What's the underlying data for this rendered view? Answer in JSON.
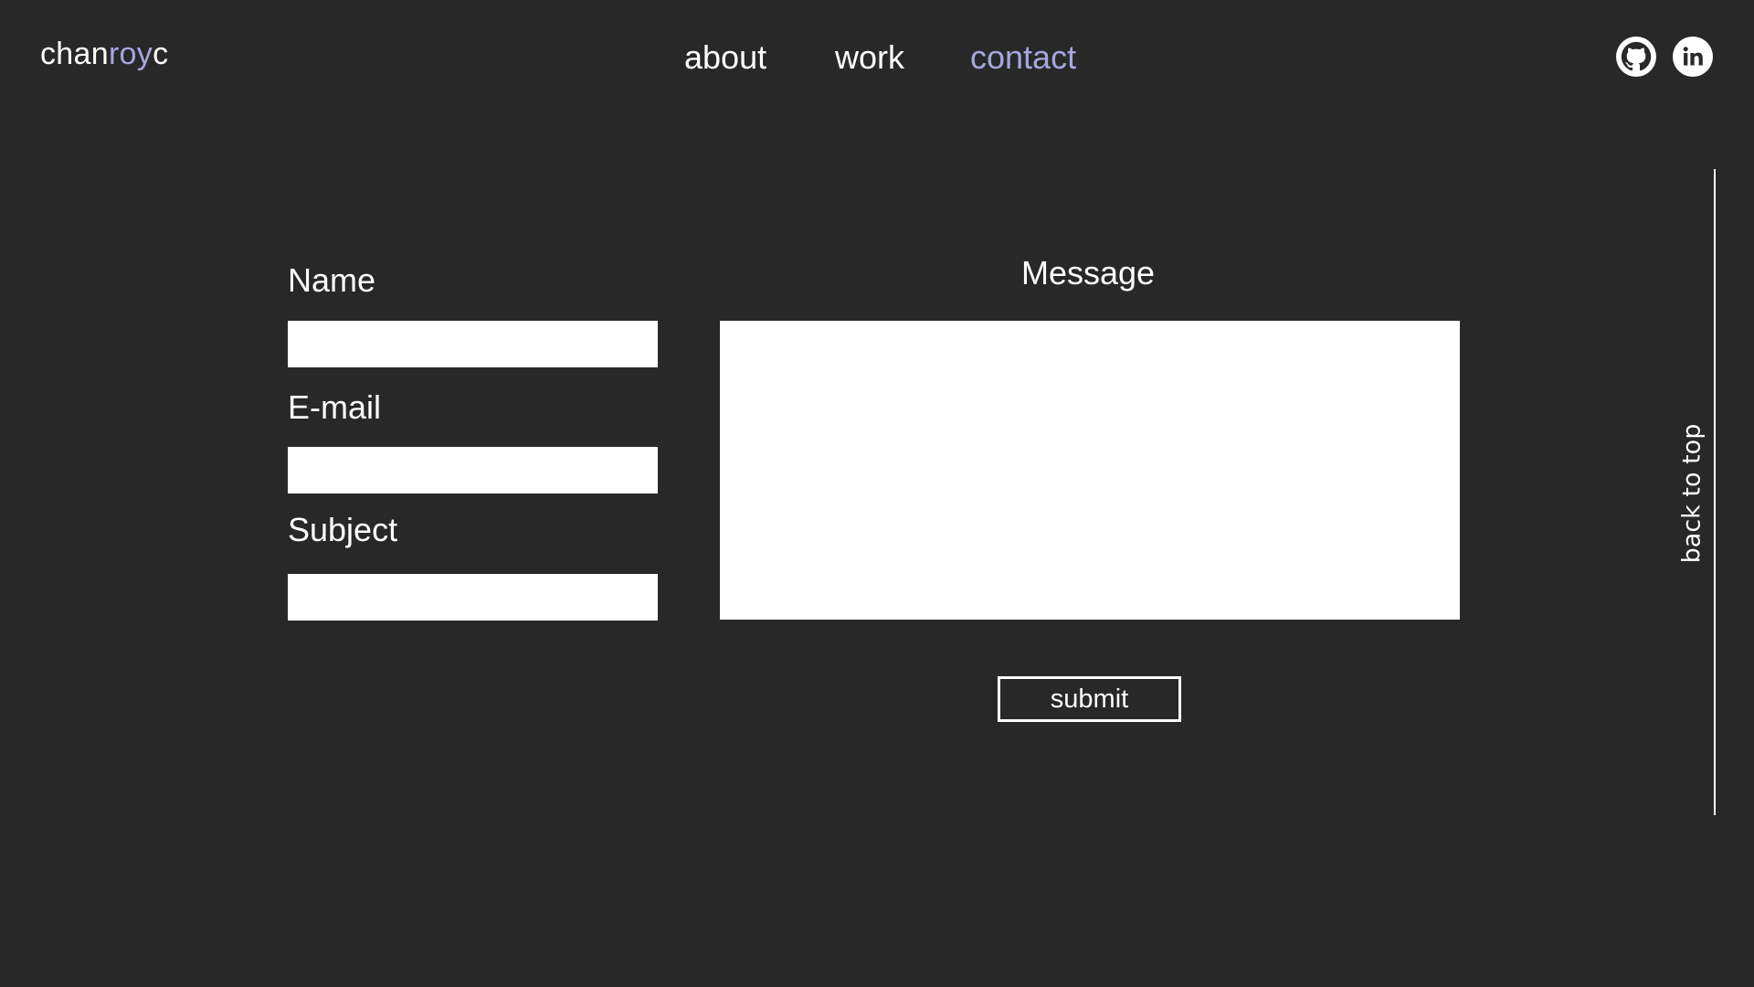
{
  "header": {
    "logo": {
      "prefix": "chan",
      "accent": "roy",
      "suffix": "c"
    },
    "nav": [
      {
        "label": "about",
        "active": false
      },
      {
        "label": "work",
        "active": false
      },
      {
        "label": "contact",
        "active": true
      }
    ],
    "social": [
      {
        "icon": "github-icon"
      },
      {
        "icon": "linkedin-icon"
      }
    ]
  },
  "form": {
    "name_label": "Name",
    "name_value": "",
    "email_label": "E-mail",
    "email_value": "",
    "subject_label": "Subject",
    "subject_value": "",
    "message_label": "Message",
    "message_value": "",
    "submit_label": "submit"
  },
  "sidebar": {
    "back_to_top_label": "back to top"
  },
  "colors": {
    "background": "#282828",
    "accent": "#a6a6e0",
    "text": "#ffffff",
    "field": "#ffffff"
  }
}
